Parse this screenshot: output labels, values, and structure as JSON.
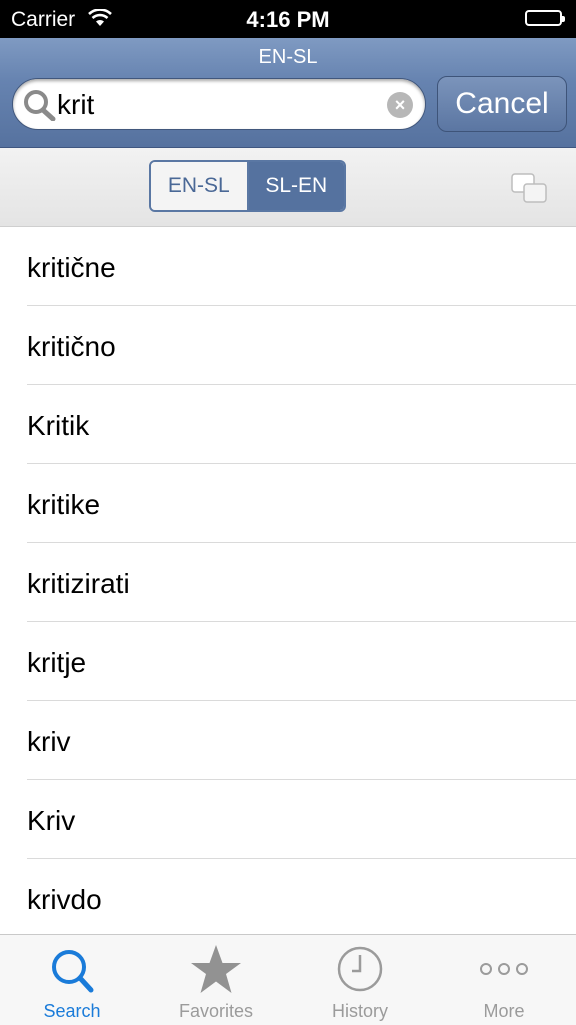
{
  "status_bar": {
    "carrier": "Carrier",
    "time": "4:16 PM"
  },
  "nav": {
    "title": "EN-SL",
    "search_query": "krit",
    "cancel_label": "Cancel"
  },
  "segmented": {
    "options": [
      "EN-SL",
      "SL-EN"
    ],
    "selected": "SL-EN"
  },
  "results": [
    "kritične",
    "kritično",
    "Kritik",
    "kritike",
    "kritizirati",
    "kritje",
    "kriv",
    "Kriv",
    "krivdo"
  ],
  "tabs": [
    {
      "label": "Search",
      "icon": "search-icon",
      "active": true
    },
    {
      "label": "Favorites",
      "icon": "star-icon",
      "active": false
    },
    {
      "label": "History",
      "icon": "clock-icon",
      "active": false
    },
    {
      "label": "More",
      "icon": "more-dots-icon",
      "active": false
    }
  ],
  "colors": {
    "nav": "#6683b0",
    "accent": "#1a7bd9",
    "segment_selected": "#55729f"
  }
}
